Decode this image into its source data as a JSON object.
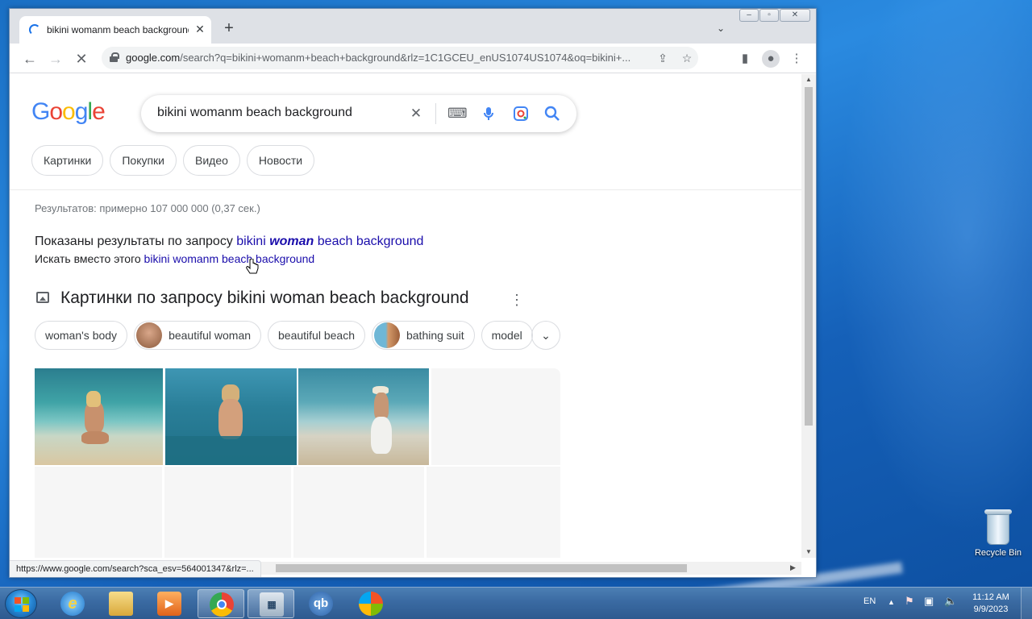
{
  "browser": {
    "tab_title": "bikini womanm beach background",
    "url_host": "google.com",
    "url_path": "/search?q=bikini+womanm+beach+background&rlz=1C1GCEU_enUS1074US1074&oq=bikini+...",
    "status_url": "https://www.google.com/search?sca_esv=564001347&rlz=..."
  },
  "search": {
    "query": "bikini womanm beach background",
    "tabs": [
      "Картинки",
      "Покупки",
      "Видео",
      "Новости"
    ],
    "stats": "Результатов: примерно 107 000 000 (0,37 сек.)",
    "showing_prefix": "Показаны результаты по запросу",
    "showing_query_1": "bikini",
    "showing_query_2": "woman",
    "showing_query_3": "beach background",
    "instead_prefix": "Искать вместо этого",
    "instead_query": "bikini womanm beach background",
    "images_heading": "Картинки по запросу bikini woman beach background",
    "related": [
      "woman's body",
      "beautiful woman",
      "beautiful beach",
      "bathing suit",
      "model"
    ]
  },
  "desktop": {
    "recycle_bin": "Recycle Bin"
  },
  "taskbar": {
    "lang": "EN",
    "time": "11:12 AM",
    "date": "9/9/2023",
    "apps": [
      "internet-explorer",
      "file-explorer",
      "media-player",
      "chrome",
      "calculator",
      "qbittorrent",
      "windows-update"
    ],
    "qb_label": "qb"
  },
  "colors": {
    "link": "#1a0dab",
    "google_blue": "#4285f4",
    "google_red": "#ea4335",
    "google_yellow": "#fbbc05",
    "google_green": "#34a853"
  }
}
